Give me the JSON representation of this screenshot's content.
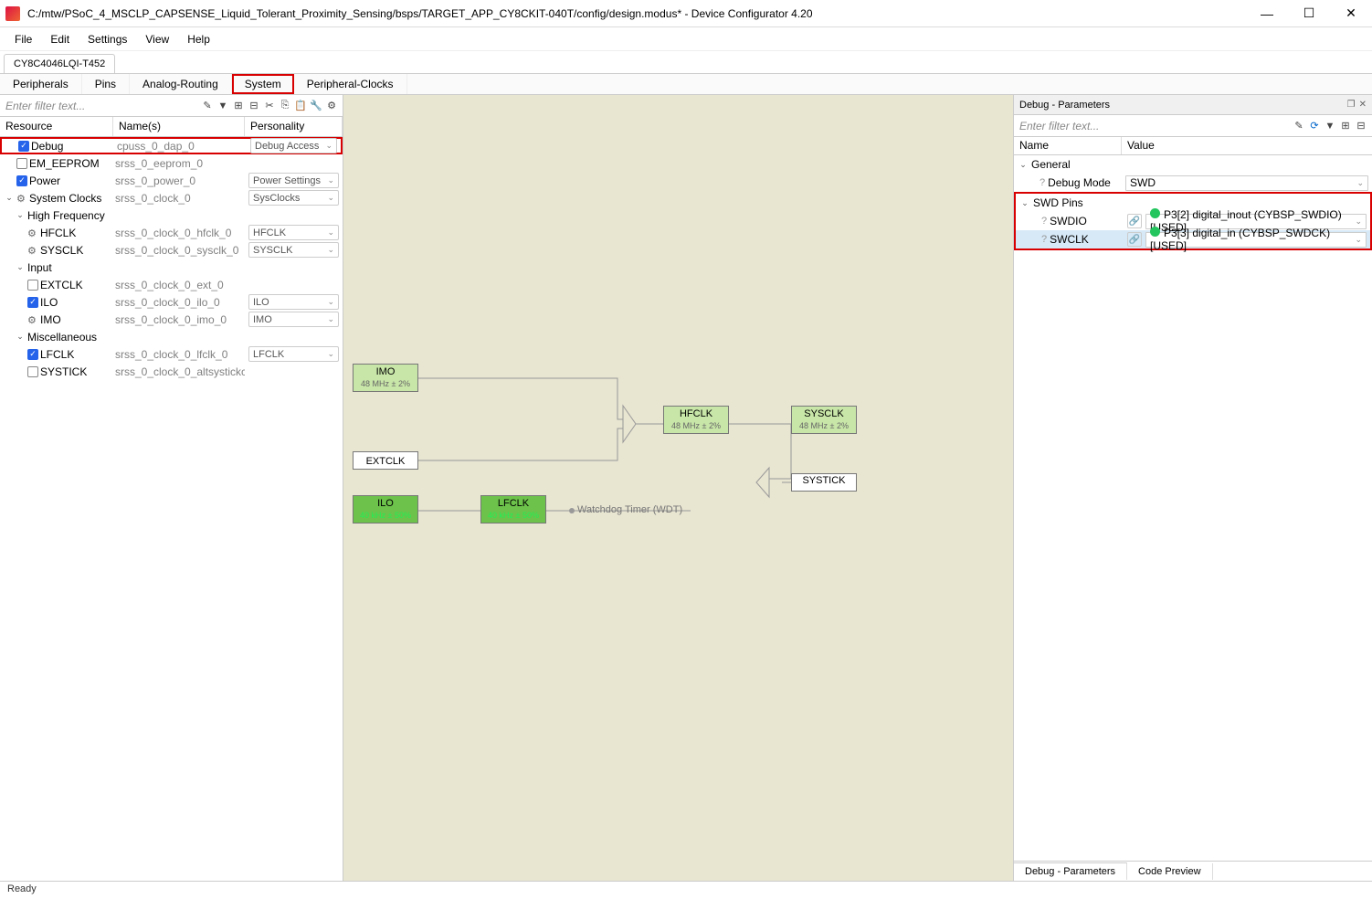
{
  "window": {
    "title": "C:/mtw/PSoC_4_MSCLP_CAPSENSE_Liquid_Tolerant_Proximity_Sensing/bsps/TARGET_APP_CY8CKIT-040T/config/design.modus* - Device Configurator 4.20",
    "minimize": "—",
    "maximize": "☐",
    "close": "✕"
  },
  "menu": {
    "file": "File",
    "edit": "Edit",
    "settings": "Settings",
    "view": "View",
    "help": "Help"
  },
  "device_tab": "CY8C4046LQI-T452",
  "section_tabs": {
    "peripherals": "Peripherals",
    "pins": "Pins",
    "analog": "Analog-Routing",
    "system": "System",
    "pclocks": "Peripheral-Clocks"
  },
  "filter_placeholder": "Enter filter text...",
  "left": {
    "col_resource": "Resource",
    "col_names": "Name(s)",
    "col_personality": "Personality",
    "rows": {
      "debug": {
        "label": "Debug",
        "name": "cpuss_0_dap_0",
        "pers": "Debug Access"
      },
      "em_eeprom": {
        "label": "EM_EEPROM",
        "name": "srss_0_eeprom_0"
      },
      "power": {
        "label": "Power",
        "name": "srss_0_power_0",
        "pers": "Power Settings"
      },
      "sysclk": {
        "label": "System Clocks",
        "name": "srss_0_clock_0",
        "pers": "SysClocks"
      },
      "highfreq": {
        "label": "High Frequency"
      },
      "hfclk": {
        "label": "HFCLK",
        "name": "srss_0_clock_0_hfclk_0",
        "pers": "HFCLK"
      },
      "sysclkc": {
        "label": "SYSCLK",
        "name": "srss_0_clock_0_sysclk_0",
        "pers": "SYSCLK"
      },
      "input": {
        "label": "Input"
      },
      "extclk": {
        "label": "EXTCLK",
        "name": "srss_0_clock_0_ext_0"
      },
      "ilo": {
        "label": "ILO",
        "name": "srss_0_clock_0_ilo_0",
        "pers": "ILO"
      },
      "imo": {
        "label": "IMO",
        "name": "srss_0_clock_0_imo_0",
        "pers": "IMO"
      },
      "misc": {
        "label": "Miscellaneous"
      },
      "lfclk": {
        "label": "LFCLK",
        "name": "srss_0_clock_0_lfclk_0",
        "pers": "LFCLK"
      },
      "systick": {
        "label": "SYSTICK",
        "name": "srss_0_clock_0_altsystickclk_0"
      }
    }
  },
  "canvas": {
    "imo": {
      "title": "IMO",
      "sub": "48 MHz ± 2%"
    },
    "extclk": {
      "title": "EXTCLK"
    },
    "hfclk": {
      "title": "HFCLK",
      "sub": "48 MHz ± 2%"
    },
    "sysclk": {
      "title": "SYSCLK",
      "sub": "48 MHz ± 2%"
    },
    "systick": {
      "title": "SYSTICK"
    },
    "ilo": {
      "title": "ILO",
      "sub": "40 kHz ± 50%"
    },
    "lfclk": {
      "title": "LFCLK",
      "sub": "40 kHz ± 50%"
    },
    "wdt": "Watchdog Timer (WDT)"
  },
  "right": {
    "panel_title": "Debug - Parameters",
    "col_name": "Name",
    "col_value": "Value",
    "general": "General",
    "debug_mode": {
      "label": "Debug Mode",
      "value": "SWD"
    },
    "swd_pins": "SWD Pins",
    "swdio": {
      "label": "SWDIO",
      "value": "P3[2] digital_inout (CYBSP_SWDIO) [USED]"
    },
    "swclk": {
      "label": "SWCLK",
      "value": "P3[3] digital_in (CYBSP_SWDCK) [USED]"
    },
    "bottom_tab1": "Debug - Parameters",
    "bottom_tab2": "Code Preview"
  },
  "status": "Ready"
}
